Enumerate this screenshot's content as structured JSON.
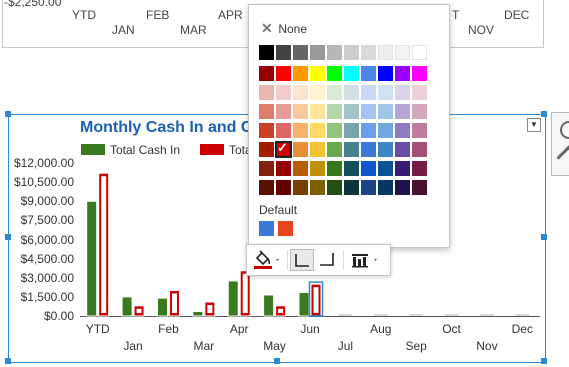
{
  "top_chart": {
    "first_value_label": "-$2,250.00",
    "x_labels_row1": [
      "YTD",
      "FEB",
      "APR",
      "T",
      "DEC"
    ],
    "x_labels_row2": [
      "JAN",
      "MAR",
      "NOV"
    ]
  },
  "main_chart": {
    "title": "Monthly Cash In and C",
    "legend": [
      {
        "label": "Total Cash In",
        "color": "#3a7a1e"
      },
      {
        "label": "Tota",
        "color": "#cc0000"
      }
    ],
    "menu_toggle_icon": "chevron-down-icon"
  },
  "chart_data": {
    "type": "bar",
    "title": "Monthly Cash In and C",
    "categories": [
      "YTD",
      "Jan",
      "Feb",
      "Mar",
      "Apr",
      "May",
      "Jun",
      "Jul",
      "Aug",
      "Sep",
      "Oct",
      "Nov",
      "Dec"
    ],
    "x_labels_upper": [
      "YTD",
      "Feb",
      "Apr",
      "Jun",
      "Aug",
      "Oct",
      "Dec"
    ],
    "x_labels_lower": [
      "Jan",
      "Mar",
      "May",
      "Jul",
      "Sep",
      "Nov"
    ],
    "y_tick_labels": [
      "$12,000.00",
      "$10,500.00",
      "$9,000.00",
      "$7,500.00",
      "$6,000.00",
      "$4,500.00",
      "$3,000.00",
      "$1,500.00",
      "$0.00"
    ],
    "y_ticks": [
      12000,
      10500,
      9000,
      7500,
      6000,
      4500,
      3000,
      1500,
      0
    ],
    "ylim": [
      0,
      12000
    ],
    "series": [
      {
        "name": "Total Cash In",
        "color": "#3a7a1e",
        "values": [
          9000,
          1500,
          1400,
          350,
          2750,
          1650,
          1850,
          0,
          0,
          0,
          0,
          0,
          0
        ]
      },
      {
        "name": "Tota",
        "color": "#cc0000",
        "values": [
          11200,
          800,
          2000,
          1100,
          3550,
          800,
          2500,
          0,
          0,
          0,
          0,
          0,
          0
        ]
      }
    ],
    "grid": false,
    "legend_position": "top-left"
  },
  "palette": {
    "none_label": "None",
    "default_label": "Default",
    "rows": [
      [
        "#000000",
        "#434343",
        "#666666",
        "#999999",
        "#b7b7b7",
        "#cccccc",
        "#d9d9d9",
        "#efefef",
        "#f3f3f3",
        "#ffffff"
      ],
      [
        "#980000",
        "#ff0000",
        "#ff9900",
        "#ffff00",
        "#00ff00",
        "#00ffff",
        "#4a86e8",
        "#0000ff",
        "#9900ff",
        "#ff00ff"
      ],
      [
        "#e6b8af",
        "#f4cccc",
        "#fce5cd",
        "#fff2cc",
        "#d9ead3",
        "#d0e0e3",
        "#c9daf8",
        "#cfe2f3",
        "#d9d2e9",
        "#ead1dc"
      ],
      [
        "#dd7e6b",
        "#ea9999",
        "#f9cb9c",
        "#ffe599",
        "#b6d7a8",
        "#a2c4c9",
        "#a4c2f4",
        "#9fc5e8",
        "#b4a7d6",
        "#d5a6bd"
      ],
      [
        "#cc4125",
        "#e06666",
        "#f6b26b",
        "#ffd966",
        "#93c47d",
        "#76a5af",
        "#6d9eeb",
        "#6fa8dc",
        "#8e7cc3",
        "#c27ba0"
      ],
      [
        "#a61c00",
        "#cc0000",
        "#e69138",
        "#f1c232",
        "#6aa84f",
        "#45818e",
        "#3c78d8",
        "#3d85c6",
        "#674ea7",
        "#a64d79"
      ],
      [
        "#85200c",
        "#990000",
        "#b45f06",
        "#bf9000",
        "#38761d",
        "#134f5c",
        "#1155cc",
        "#0b5394",
        "#351c75",
        "#741b47"
      ],
      [
        "#5b0f00",
        "#660000",
        "#783f04",
        "#7f6000",
        "#274e13",
        "#0c343d",
        "#1c4587",
        "#073763",
        "#20124d",
        "#4c1130"
      ]
    ],
    "selected": {
      "row": 5,
      "col": 1
    },
    "default_colors": [
      "#3c78d8",
      "#e8461e"
    ]
  },
  "toolbar": {
    "fill_color_icon": "paint-bucket-icon",
    "fill_color_value": "#cc0000",
    "border_left_icon": "border-left-bottom-icon",
    "border_right_icon": "border-right-bottom-icon",
    "chart_type_icon": "bar-chart-icon"
  }
}
